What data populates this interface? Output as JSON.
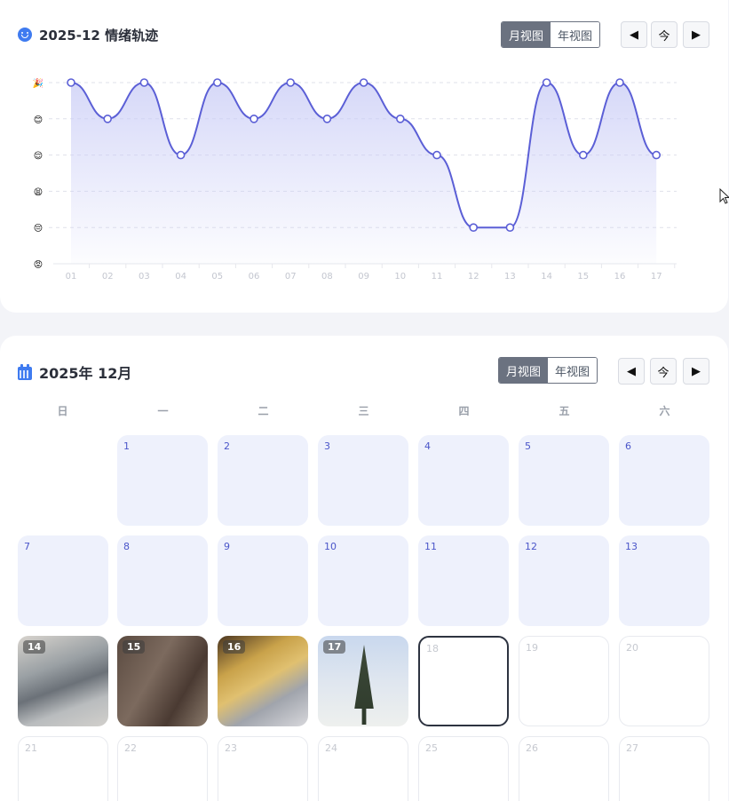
{
  "mood_card": {
    "title": "2025-12 情绪轨迹",
    "view_toggle": {
      "month": "月视图",
      "year": "年视图",
      "active": "month"
    },
    "nav": {
      "prev": "◀",
      "today": "今",
      "next": "▶"
    }
  },
  "chart_data": {
    "type": "line",
    "title": "2025-12 情绪轨迹",
    "x": [
      "01",
      "02",
      "03",
      "04",
      "05",
      "06",
      "07",
      "08",
      "09",
      "10",
      "11",
      "12",
      "13",
      "14",
      "15",
      "16",
      "17"
    ],
    "y_levels": [
      "🎉",
      "😊",
      "😌",
      "😫",
      "😔",
      "😡"
    ],
    "series": [
      {
        "values": [
          5,
          4,
          5,
          3,
          5,
          4,
          5,
          4,
          5,
          4,
          3,
          1,
          1,
          5,
          3,
          5,
          3
        ]
      }
    ],
    "ylim": [
      0,
      5
    ],
    "line_color": "#5b5fd6",
    "fill_color": "#c9ccf6",
    "grid": true
  },
  "calendar_card": {
    "title": "2025年 12月",
    "view_toggle": {
      "month": "月视图",
      "year": "年视图",
      "active": "month"
    },
    "nav": {
      "prev": "◀",
      "today": "今",
      "next": "▶"
    },
    "weekdays": [
      "日",
      "一",
      "二",
      "三",
      "四",
      "五",
      "六"
    ],
    "today": "18",
    "days": [
      {
        "num": "1",
        "state": "past"
      },
      {
        "num": "2",
        "state": "past"
      },
      {
        "num": "3",
        "state": "past"
      },
      {
        "num": "4",
        "state": "past"
      },
      {
        "num": "5",
        "state": "past"
      },
      {
        "num": "6",
        "state": "past"
      },
      {
        "num": "7",
        "state": "past"
      },
      {
        "num": "8",
        "state": "past"
      },
      {
        "num": "9",
        "state": "past"
      },
      {
        "num": "10",
        "state": "past"
      },
      {
        "num": "11",
        "state": "past"
      },
      {
        "num": "12",
        "state": "past"
      },
      {
        "num": "13",
        "state": "past"
      },
      {
        "num": "14",
        "state": "photo"
      },
      {
        "num": "15",
        "state": "photo"
      },
      {
        "num": "16",
        "state": "photo"
      },
      {
        "num": "17",
        "state": "photo"
      },
      {
        "num": "18",
        "state": "today"
      },
      {
        "num": "19",
        "state": "future"
      },
      {
        "num": "20",
        "state": "future"
      },
      {
        "num": "21",
        "state": "future"
      },
      {
        "num": "22",
        "state": "future"
      },
      {
        "num": "23",
        "state": "future"
      },
      {
        "num": "24",
        "state": "future"
      },
      {
        "num": "25",
        "state": "future"
      },
      {
        "num": "26",
        "state": "future"
      },
      {
        "num": "27",
        "state": "future"
      }
    ]
  }
}
